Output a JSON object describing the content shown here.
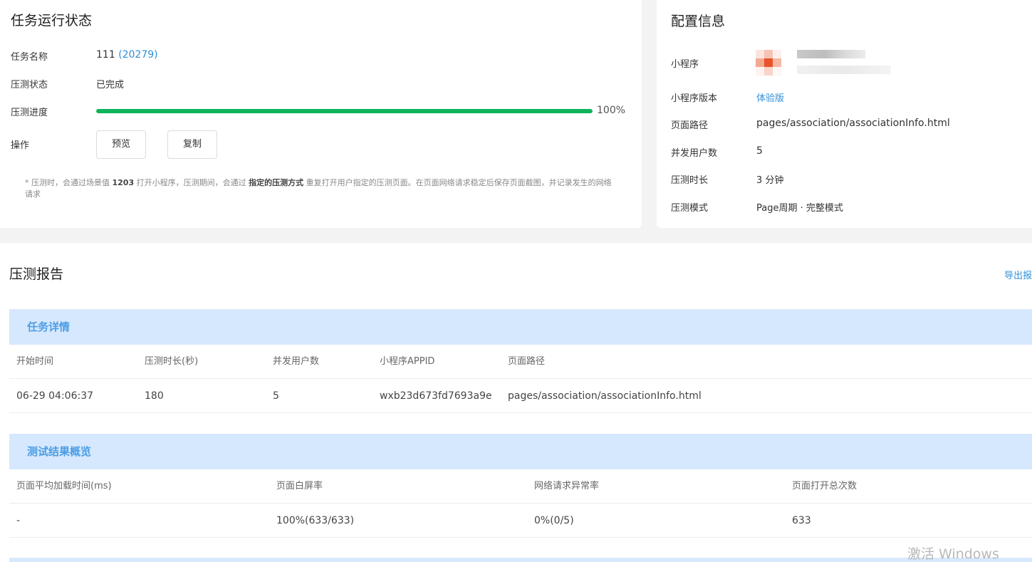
{
  "status": {
    "title": "任务运行状态",
    "rows": {
      "task_name_label": "任务名称",
      "task_name_value": "111",
      "task_id": "(20279)",
      "state_label": "压测状态",
      "state_value": "已完成",
      "progress_label": "压测进度",
      "progress_value": 1.0,
      "progress_text": "100%",
      "ops_label": "操作",
      "preview_button": "预览",
      "copy_button": "复制"
    },
    "note": {
      "part1": "* 压测时，会通过场景值 ",
      "scene": "1203",
      "part2": " 打开小程序，压测期间，会通过 ",
      "mode": "指定的压测方式",
      "part3": " 重复打开用户指定的压测页面。在页面网络请求稳定后保存页面截图，并记录发生的网络请求"
    }
  },
  "config": {
    "title": "配置信息",
    "mini_program_label": "小程序",
    "version_label": "小程序版本",
    "version_value": "体验版",
    "path_label": "页面路径",
    "path_value": "pages/association/associationInfo.html",
    "users_label": "并发用户数",
    "users_value": "5",
    "duration_label": "压测时长",
    "duration_value": "3 分钟",
    "mode_label": "压测模式",
    "mode_value": "Page周期 · 完整模式"
  },
  "report": {
    "title": "压测报告",
    "export_link": "导出报",
    "task_detail": {
      "heading": "任务详情",
      "headers": [
        "开始时间",
        "压测时长(秒)",
        "并发用户数",
        "小程序APPID",
        "页面路径"
      ],
      "row": [
        "06-29 04:06:37",
        "180",
        "5",
        "wxb23d673fd7693a9e",
        "pages/association/associationInfo.html"
      ]
    },
    "overview": {
      "heading": "测试结果概览",
      "headers": [
        "页面平均加载时间(ms)",
        "页面白屏率",
        "网络请求异常率",
        "页面打开总次数"
      ],
      "row": [
        "-",
        "100%(633/633)",
        "0%(0/5)",
        "633"
      ]
    }
  },
  "watermark": "激活 Windows",
  "colors": {
    "accent": "#2f8fd8",
    "progress": "#0db35a",
    "section_bg": "#d6e8fd",
    "section_text": "#4b9de4"
  }
}
